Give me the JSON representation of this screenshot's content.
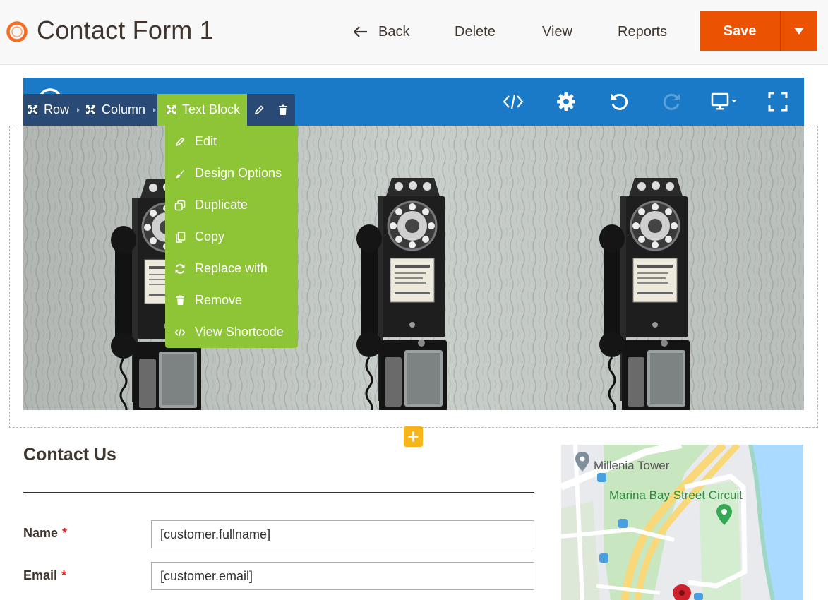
{
  "header": {
    "title": "Contact Form 1",
    "back_label": "Back",
    "delete_label": "Delete",
    "view_label": "View",
    "reports_label": "Reports",
    "save_label": "Save"
  },
  "breadcrumb": {
    "row_label": "Row",
    "column_label": "Column",
    "block_label": "Text Block"
  },
  "context_menu": {
    "items": [
      {
        "label": "Edit",
        "icon": "pencil-icon"
      },
      {
        "label": "Design Options",
        "icon": "brush-icon"
      },
      {
        "label": "Duplicate",
        "icon": "duplicate-icon"
      },
      {
        "label": "Copy",
        "icon": "copy-icon"
      },
      {
        "label": "Replace with",
        "icon": "refresh-icon"
      },
      {
        "label": "Remove",
        "icon": "trash-icon"
      },
      {
        "label": "View Shortcode",
        "icon": "code-icon"
      }
    ]
  },
  "toolbar_icons": [
    "code-icon",
    "gear-icon",
    "undo-icon",
    "redo-icon",
    "monitor-icon",
    "fullscreen-icon"
  ],
  "form": {
    "heading": "Contact Us",
    "name_label": "Name",
    "name_value": "[customer.fullname]",
    "email_label": "Email",
    "email_value": "[customer.email]",
    "required_mark": "*"
  },
  "map": {
    "label_tower": "Millenia Tower",
    "label_circuit": "Marina Bay Street Circuit"
  },
  "colors": {
    "brand_orange": "#eb5202",
    "builder_blue": "#1b7ac8",
    "breadcrumb_navy": "#294a75",
    "menu_green": "#8ec537",
    "add_yellow": "#f5b51b"
  }
}
